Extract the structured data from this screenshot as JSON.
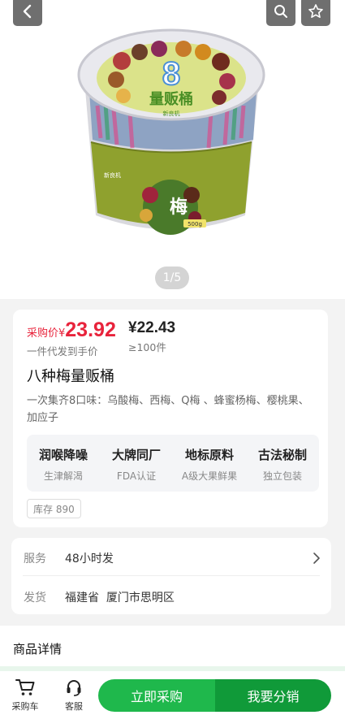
{
  "hero": {
    "pager": "1/5",
    "product_image": {
      "lid_number": "8",
      "lid_text": "量贩桶",
      "brand": "新良机",
      "label_char": "梅",
      "label_weight": "500g"
    }
  },
  "price": {
    "purchase_label": "采购价¥",
    "purchase_value": "23.92",
    "purchase_sub": "一件代发到手价",
    "bulk_value": "¥22.43",
    "bulk_sub": "≥100件"
  },
  "product": {
    "title": "八种梅量贩桶",
    "description": "一次集齐8口味：乌酸梅、西梅、Q梅 、蜂蜜杨梅、樱桃果、加应子",
    "features": [
      {
        "title": "润喉降噪",
        "sub": "生津解渴"
      },
      {
        "title": "大牌同厂",
        "sub": "FDA认证"
      },
      {
        "title": "地标原料",
        "sub": "A级大果鲜果"
      },
      {
        "title": "古法秘制",
        "sub": "独立包装"
      }
    ],
    "stock": "库存 890"
  },
  "service": {
    "service_label": "服务",
    "service_value": "48小时发",
    "ship_label": "发货",
    "ship_value": "福建省  厦门市思明区"
  },
  "details": {
    "title": "商品详情"
  },
  "bottom": {
    "cart_label": "采购车",
    "support_label": "客服",
    "buy_label": "立即采购",
    "distribute_label": "我要分销"
  },
  "colors": {
    "price_red": "#e8233b",
    "brand_green": "#1fb84c",
    "brand_green_dark": "#109a39"
  },
  "icons": [
    "back-arrow-icon",
    "search-icon",
    "star-icon",
    "chevron-right-icon",
    "cart-icon",
    "headset-icon"
  ]
}
